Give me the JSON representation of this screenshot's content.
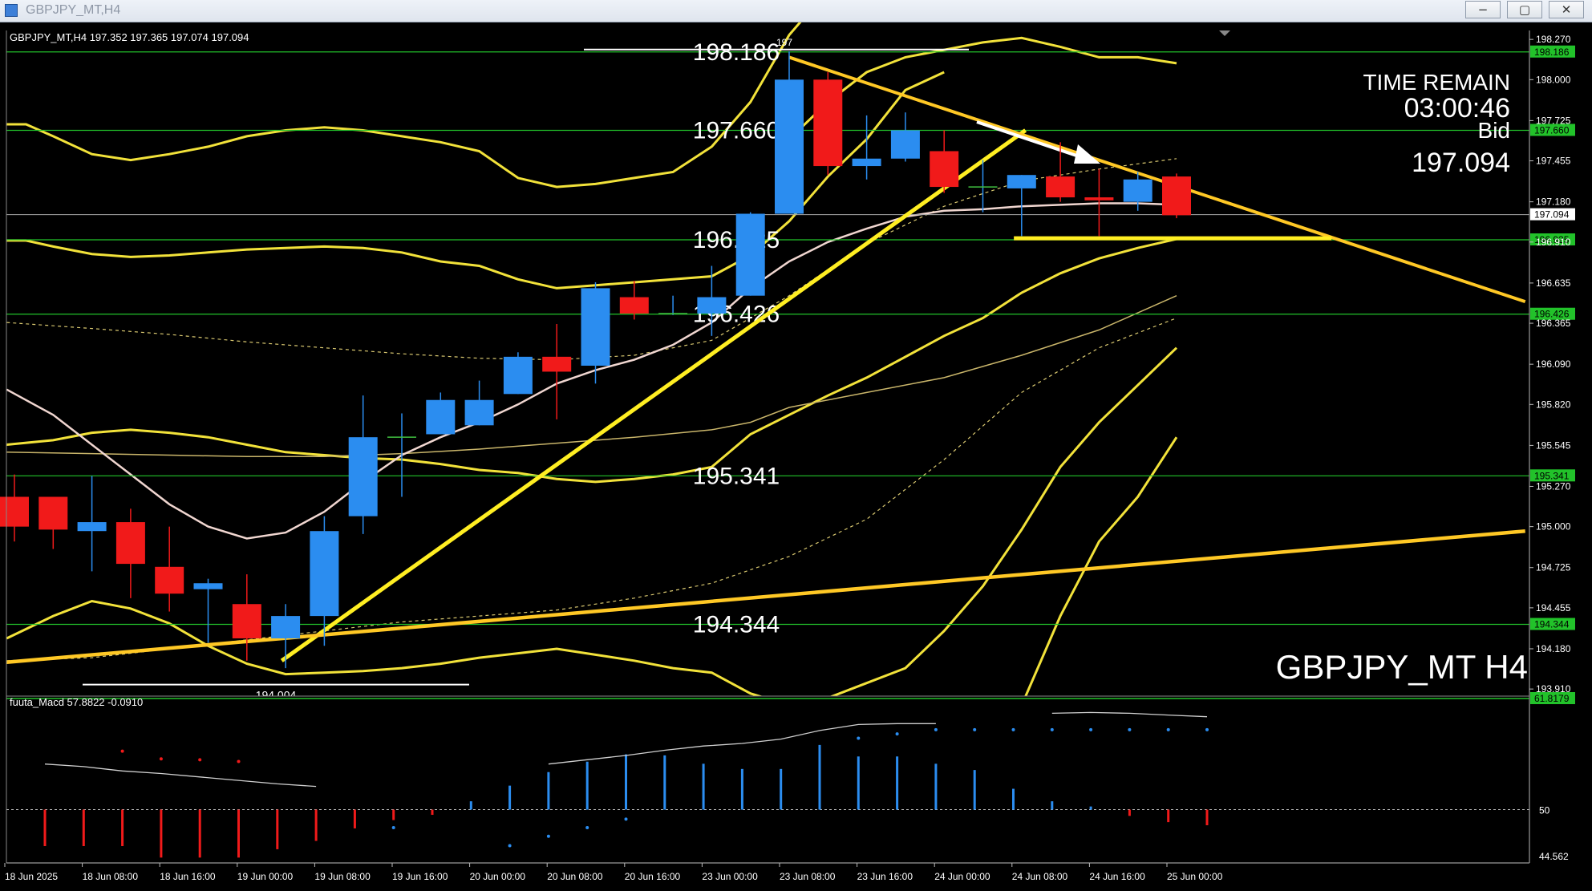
{
  "window": {
    "title": "GBPJPY_MT,H4",
    "controls": [
      "−",
      "▢",
      "✕"
    ]
  },
  "chart_data": {
    "type": "candlestick",
    "symbol_info": "GBPJPY_MT,H4  197.352 197.365 197.074 197.094",
    "watermark": "GBPJPY_MT H4",
    "info_panel": {
      "line1": "TIME REMAIN",
      "line2": "03:00:46",
      "line3": "Bid",
      "line4": "197.094"
    },
    "price_axis": [
      "198.270",
      "198.000",
      "197.725",
      "197.455",
      "197.180",
      "196.910",
      "196.635",
      "196.365",
      "196.090",
      "195.820",
      "195.545",
      "195.270",
      "195.000",
      "194.725",
      "194.455",
      "194.180",
      "193.910"
    ],
    "ylim": [
      193.9,
      198.33
    ],
    "time_axis": [
      "18 Jun 2025",
      "18 Jun 08:00",
      "18 Jun 16:00",
      "19 Jun 00:00",
      "19 Jun 08:00",
      "19 Jun 16:00",
      "20 Jun 00:00",
      "20 Jun 08:00",
      "20 Jun 16:00",
      "23 Jun 00:00",
      "23 Jun 08:00",
      "23 Jun 16:00",
      "24 Jun 00:00",
      "24 Jun 08:00",
      "24 Jun 16:00",
      "25 Jun 00:00"
    ],
    "candles": [
      {
        "o": 195.2,
        "h": 195.35,
        "l": 194.9,
        "c": 195.0
      },
      {
        "o": 195.2,
        "h": 195.2,
        "l": 194.85,
        "c": 194.98
      },
      {
        "o": 194.97,
        "h": 195.34,
        "l": 194.7,
        "c": 195.03
      },
      {
        "o": 195.03,
        "h": 195.12,
        "l": 194.52,
        "c": 194.75
      },
      {
        "o": 194.73,
        "h": 195.0,
        "l": 194.43,
        "c": 194.55
      },
      {
        "o": 194.58,
        "h": 194.65,
        "l": 194.22,
        "c": 194.62
      },
      {
        "o": 194.48,
        "h": 194.68,
        "l": 194.1,
        "c": 194.25
      },
      {
        "o": 194.25,
        "h": 194.48,
        "l": 194.05,
        "c": 194.4
      },
      {
        "o": 194.4,
        "h": 195.07,
        "l": 194.2,
        "c": 194.97
      },
      {
        "o": 195.07,
        "h": 195.88,
        "l": 194.95,
        "c": 195.6
      },
      {
        "o": 195.6,
        "h": 195.76,
        "l": 195.2,
        "c": 195.6
      },
      {
        "o": 195.62,
        "h": 195.9,
        "l": 195.62,
        "c": 195.85
      },
      {
        "o": 195.68,
        "h": 195.98,
        "l": 195.68,
        "c": 195.85
      },
      {
        "o": 195.89,
        "h": 196.17,
        "l": 195.89,
        "c": 196.14
      },
      {
        "o": 196.14,
        "h": 196.36,
        "l": 195.72,
        "c": 196.04
      },
      {
        "o": 196.08,
        "h": 196.64,
        "l": 195.96,
        "c": 196.6
      },
      {
        "o": 196.54,
        "h": 196.65,
        "l": 196.39,
        "c": 196.43
      },
      {
        "o": 196.43,
        "h": 196.55,
        "l": 196.42,
        "c": 196.43
      },
      {
        "o": 196.43,
        "h": 196.75,
        "l": 196.28,
        "c": 196.54
      },
      {
        "o": 196.55,
        "h": 197.11,
        "l": 196.55,
        "c": 197.1
      },
      {
        "o": 197.1,
        "h": 198.19,
        "l": 197.1,
        "c": 198.0
      },
      {
        "o": 198.0,
        "h": 198.05,
        "l": 197.36,
        "c": 197.42
      },
      {
        "o": 197.42,
        "h": 197.76,
        "l": 197.33,
        "c": 197.47
      },
      {
        "o": 197.47,
        "h": 197.78,
        "l": 197.45,
        "c": 197.66
      },
      {
        "o": 197.52,
        "h": 197.66,
        "l": 197.24,
        "c": 197.28
      },
      {
        "o": 197.28,
        "h": 197.46,
        "l": 197.11,
        "c": 197.28
      },
      {
        "o": 197.27,
        "h": 197.36,
        "l": 196.95,
        "c": 197.36
      },
      {
        "o": 197.35,
        "h": 197.58,
        "l": 197.18,
        "c": 197.21
      },
      {
        "o": 197.21,
        "h": 197.4,
        "l": 196.95,
        "c": 197.19
      },
      {
        "o": 197.18,
        "h": 197.38,
        "l": 197.12,
        "c": 197.33
      },
      {
        "o": 197.35,
        "h": 197.37,
        "l": 197.07,
        "c": 197.09
      }
    ],
    "levels": [
      "198.186",
      "197.660",
      "196.925",
      "196.426",
      "195.341",
      "194.344",
      "193.771"
    ],
    "low_label": "194.004",
    "high_label": "197",
    "indicator": {
      "label": "fuuta_Macd 57.8822  -0.0910",
      "axis": [
        "61.8179",
        "50",
        "44.562"
      ],
      "ylim": [
        43.8,
        63.2
      ],
      "signal_line": [
        55.3,
        55.0,
        54.5,
        54.2,
        53.8,
        53.4,
        53.0,
        52.7,
        null,
        null,
        null,
        null,
        null,
        55.3,
        55.8,
        56.3,
        56.9,
        57.4,
        57.7,
        58.2,
        59.2,
        59.9,
        60.0,
        60.0,
        null,
        null,
        61.2,
        61.3,
        61.2,
        61.0,
        60.8
      ],
      "signal_dots": [
        null,
        null,
        56.8,
        55.9,
        55.8,
        55.6,
        null,
        null,
        null,
        null,
        null,
        null,
        null,
        null,
        null,
        null,
        null,
        null,
        null,
        null,
        null,
        null,
        null,
        null,
        null,
        null,
        null,
        null,
        null,
        null,
        null
      ],
      "dots_above": [
        null,
        null,
        null,
        null,
        null,
        null,
        null,
        null,
        null,
        null,
        null,
        null,
        null,
        null,
        null,
        null,
        null,
        null,
        null,
        null,
        null,
        58.3,
        58.8,
        59.3,
        59.3,
        59.3,
        59.3,
        59.3,
        59.3,
        59.3,
        59.3
      ],
      "dots_below": [
        null,
        null,
        null,
        null,
        null,
        null,
        null,
        null,
        null,
        47.9,
        null,
        null,
        45.8,
        46.9,
        47.9,
        48.9,
        null,
        null,
        null,
        null,
        null,
        null,
        null,
        null,
        null,
        null,
        null,
        null,
        null,
        null,
        null
      ],
      "hist": [
        -3.5,
        -3.5,
        -3.5,
        -4.6,
        -4.6,
        -4.6,
        -3.8,
        -3.0,
        -1.8,
        -1.0,
        -0.5,
        0.8,
        2.3,
        3.6,
        4.6,
        5.3,
        5.2,
        4.4,
        3.9,
        3.9,
        6.2,
        5.1,
        5.1,
        4.4,
        3.8,
        2.0,
        0.8,
        0.3,
        -0.6,
        -1.2,
        -1.5
      ]
    }
  }
}
